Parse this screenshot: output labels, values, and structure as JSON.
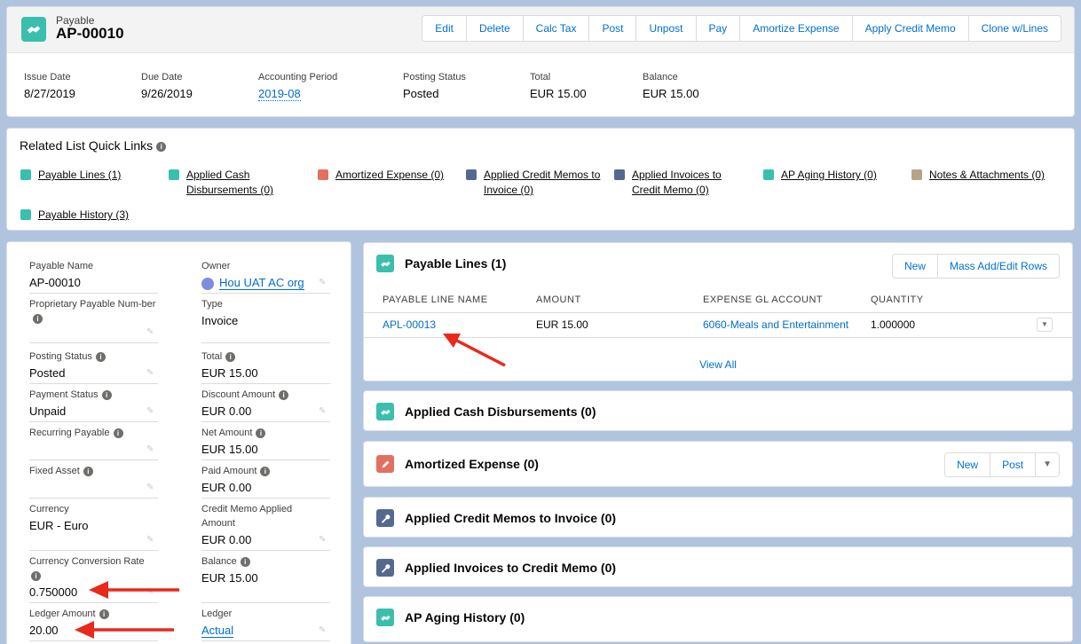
{
  "header": {
    "object_type": "Payable",
    "title": "AP-00010",
    "buttons": [
      "Edit",
      "Delete",
      "Calc Tax",
      "Post",
      "Unpost",
      "Pay",
      "Amortize Expense",
      "Apply Credit Memo",
      "Clone w/Lines"
    ],
    "highlights": [
      {
        "label": "Issue Date",
        "value": "8/27/2019"
      },
      {
        "label": "Due Date",
        "value": "9/26/2019"
      },
      {
        "label": "Accounting Period",
        "value": "2019-08"
      },
      {
        "label": "Posting Status",
        "value": "Posted"
      },
      {
        "label": "Total",
        "value": "EUR 15.00"
      },
      {
        "label": "Balance",
        "value": "EUR 15.00"
      }
    ]
  },
  "quick_links": {
    "title": "Related List Quick Links",
    "items": [
      {
        "label": "Payable Lines (1)"
      },
      {
        "label": "Applied Cash Disbursements (0)"
      },
      {
        "label": "Amortized Expense (0)"
      },
      {
        "label": "Applied Credit Memos to Invoice (0)"
      },
      {
        "label": "Applied Invoices to Credit Memo (0)"
      },
      {
        "label": "AP Aging History (0)"
      },
      {
        "label": "Notes & Attachments (0)"
      },
      {
        "label": "Payable History (3)"
      }
    ]
  },
  "details": {
    "payable_name": {
      "label": "Payable Name",
      "value": "AP-00010"
    },
    "owner": {
      "label": "Owner",
      "value": "Hou UAT AC org"
    },
    "proprietary": {
      "label": "Proprietary Payable Num-ber",
      "value": ""
    },
    "type": {
      "label": "Type",
      "value": "Invoice"
    },
    "posting_status": {
      "label": "Posting Status",
      "value": "Posted"
    },
    "total": {
      "label": "Total",
      "value": "EUR 15.00"
    },
    "payment_status": {
      "label": "Payment Status",
      "value": "Unpaid"
    },
    "discount": {
      "label": "Discount Amount",
      "value": "EUR 0.00"
    },
    "recurring": {
      "label": "Recurring Payable",
      "value": ""
    },
    "net": {
      "label": "Net Amount",
      "value": "EUR 15.00"
    },
    "fixed_asset": {
      "label": "Fixed Asset",
      "value": ""
    },
    "paid": {
      "label": "Paid Amount",
      "value": "EUR 0.00"
    },
    "currency": {
      "label": "Currency",
      "value": "EUR - Euro"
    },
    "credit_memo": {
      "label": "Credit Memo Applied Amount",
      "value": "EUR 0.00"
    },
    "conversion": {
      "label": "Currency Conversion Rate",
      "value": "0.750000"
    },
    "balance": {
      "label": "Balance",
      "value": "EUR 15.00"
    },
    "ledger_amount": {
      "label": "Ledger Amount",
      "value": "20.00"
    },
    "ledger": {
      "label": "Ledger",
      "value": "Actual"
    }
  },
  "payable_lines": {
    "title": "Payable Lines (1)",
    "buttons": [
      "New",
      "Mass Add/Edit Rows"
    ],
    "columns": [
      "PAYABLE LINE NAME",
      "AMOUNT",
      "EXPENSE GL ACCOUNT",
      "QUANTITY"
    ],
    "rows": [
      [
        "APL-00013",
        "EUR 15.00",
        "6060-Meals and Entertainment",
        "1.000000"
      ]
    ],
    "view_all": "View All"
  },
  "related": [
    {
      "title": "Applied Cash Disbursements (0)"
    },
    {
      "title": "Amortized Expense (0)",
      "buttons": [
        "New",
        "Post"
      ]
    },
    {
      "title": "Applied Credit Memos to Invoice (0)"
    },
    {
      "title": "Applied Invoices to Credit Memo (0)"
    },
    {
      "title": "AP Aging History (0)"
    }
  ],
  "colors": {
    "teal": "#3bbfad",
    "orange": "#e3705f",
    "slate": "#54698d",
    "arrow": "#e8291c"
  }
}
